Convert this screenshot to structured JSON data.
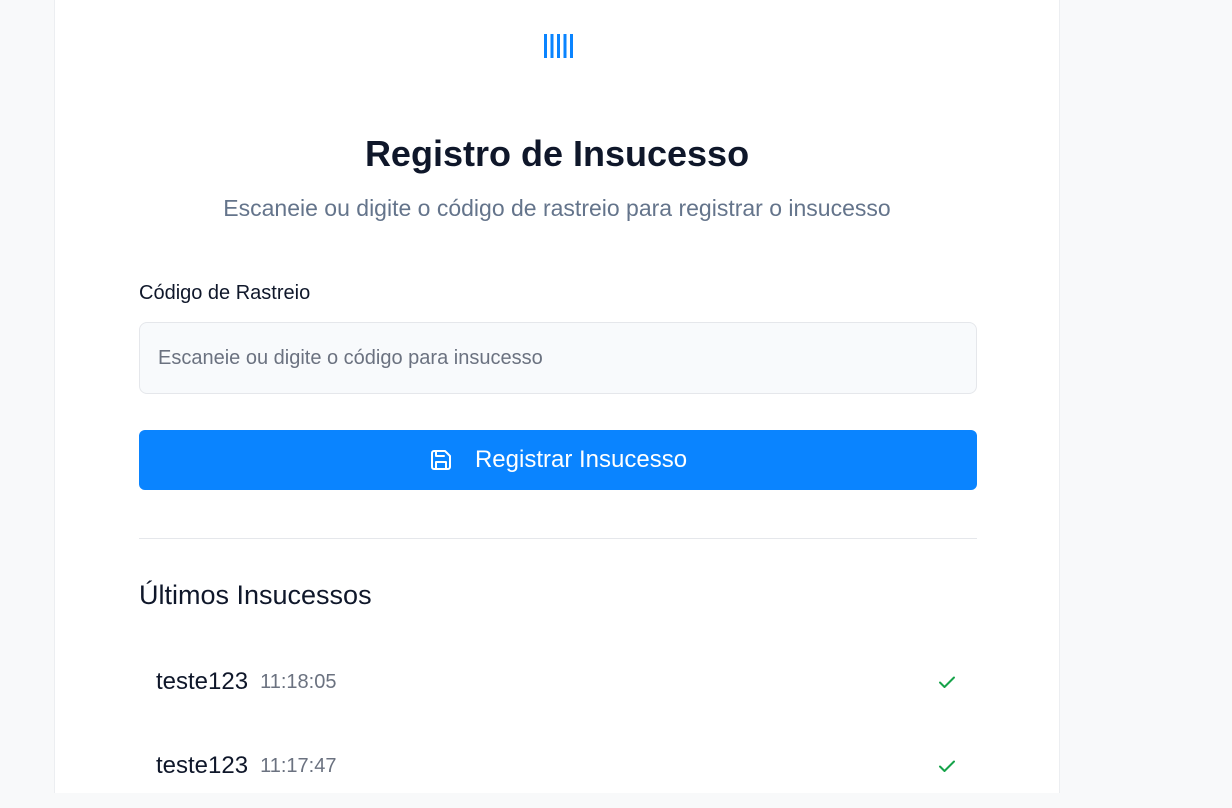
{
  "header": {
    "title": "Registro de Insucesso",
    "subtitle": "Escaneie ou digite o código de rastreio para registrar o insucesso",
    "logo_icon": "barcode-icon"
  },
  "form": {
    "field_label": "Código de Rastreio",
    "input_value": "",
    "input_placeholder": "Escaneie ou digite o código para insucesso",
    "submit_label": "Registrar Insucesso",
    "submit_icon": "save-icon"
  },
  "recent": {
    "title": "Últimos Insucessos",
    "items": [
      {
        "code": "teste123",
        "time": "11:18:05",
        "status_icon": "check-icon"
      },
      {
        "code": "teste123",
        "time": "11:17:47",
        "status_icon": "check-icon"
      }
    ]
  },
  "colors": {
    "accent": "#0A84FF",
    "success": "#16A34A",
    "muted_text": "#64748B"
  }
}
